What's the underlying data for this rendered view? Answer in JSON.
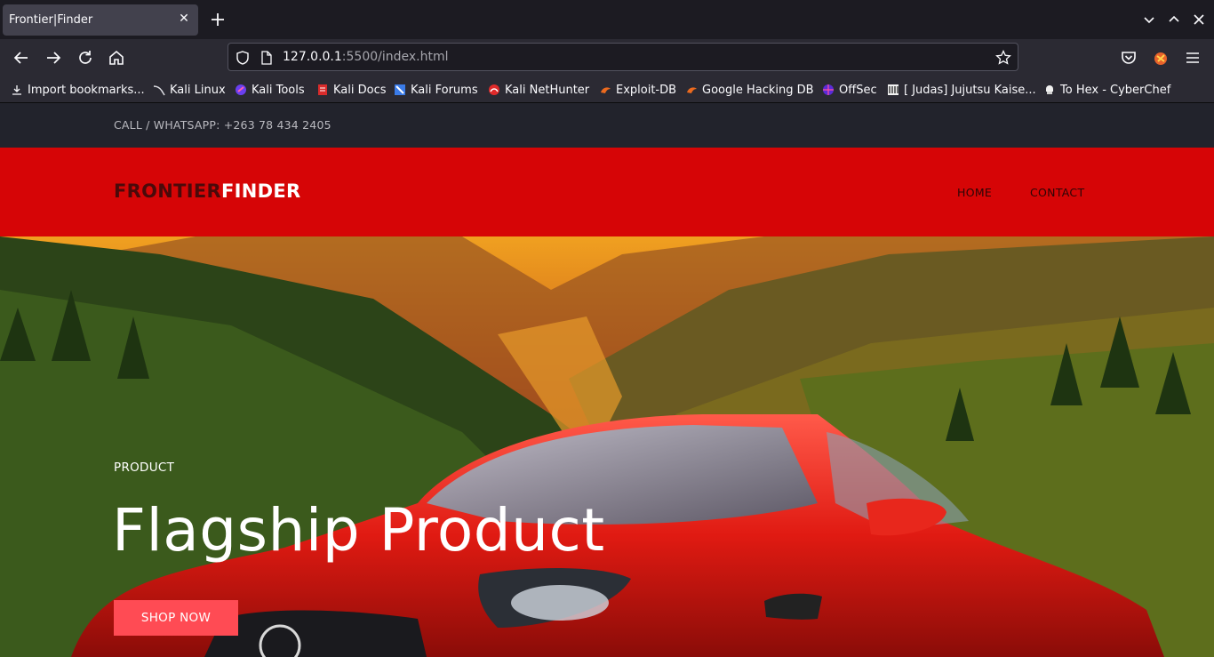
{
  "browser": {
    "tab_title": "Frontier|Finder",
    "url_host": "127.0.0.1",
    "url_rest": ":5500/index.html",
    "bookmarks": [
      {
        "label": "Import bookmarks...",
        "icon": "import-icon"
      },
      {
        "label": "Kali Linux",
        "icon": "kali-dragon-icon"
      },
      {
        "label": "Kali Tools",
        "icon": "kali-tools-icon"
      },
      {
        "label": "Kali Docs",
        "icon": "kali-docs-icon"
      },
      {
        "label": "Kali Forums",
        "icon": "kali-forums-icon"
      },
      {
        "label": "Kali NetHunter",
        "icon": "nethunter-icon"
      },
      {
        "label": "Exploit-DB",
        "icon": "exploit-db-icon"
      },
      {
        "label": "Google Hacking DB",
        "icon": "ghdb-icon"
      },
      {
        "label": "OffSec",
        "icon": "offsec-icon"
      },
      {
        "label": "[ Judas] Jujutsu Kaise...",
        "icon": "judas-icon"
      },
      {
        "label": "To Hex - CyberChef",
        "icon": "cyberchef-icon"
      }
    ]
  },
  "site": {
    "topbar": {
      "call": "CALL / WHATSAPP: +263 78 434 2405"
    },
    "logo": {
      "part1": "FRONTIER",
      "part2": "FINDER"
    },
    "nav": [
      {
        "label": "HOME"
      },
      {
        "label": "CONTACT"
      }
    ],
    "hero": {
      "eyebrow": "PRODUCT",
      "headline": "Flagship Product",
      "cta": "SHOP NOW"
    }
  },
  "colors": {
    "header_red": "#d60506",
    "cta_red": "#ff4b54",
    "topbar_dark": "#22232c"
  }
}
